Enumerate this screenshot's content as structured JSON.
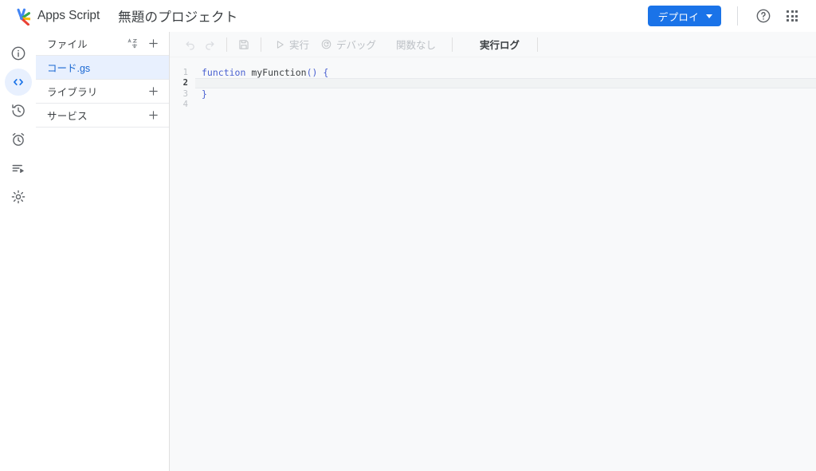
{
  "header": {
    "logo_icon": "apps-script-logo-icon",
    "brand": "Apps Script",
    "project_title": "無題のプロジェクト",
    "deploy_label": "デプロイ",
    "deploy_caret_icon": "chevron-down-icon",
    "help_icon": "help-circle-icon",
    "apps_grid_icon": "apps-grid-icon",
    "accent_color": "#1a73e8"
  },
  "rail": {
    "items": [
      {
        "name": "overview",
        "icon": "info-circle-icon",
        "active": false
      },
      {
        "name": "editor",
        "icon": "code-brackets-icon",
        "active": true
      },
      {
        "name": "project-history",
        "icon": "history-clock-icon",
        "active": false
      },
      {
        "name": "triggers",
        "icon": "alarm-clock-icon",
        "active": false
      },
      {
        "name": "executions",
        "icon": "executions-list-play-icon",
        "active": false
      },
      {
        "name": "project-settings",
        "icon": "gear-icon",
        "active": false
      }
    ],
    "active_bg": "#e8f0fe",
    "active_fg": "#1a73e8"
  },
  "panel": {
    "files_label": "ファイル",
    "sort_icon": "sort-alpha-icon",
    "add_file_icon": "plus-icon",
    "files": [
      {
        "name": "コード.gs",
        "selected": true
      }
    ],
    "libraries_label": "ライブラリ",
    "add_library_icon": "plus-icon",
    "services_label": "サービス",
    "add_service_icon": "plus-icon",
    "selected_bg": "#e8f0fe",
    "selected_fg": "#1967d2"
  },
  "toolbar": {
    "undo_icon": "undo-arrow-icon",
    "redo_icon": "redo-arrow-icon",
    "save_icon": "save-floppy-icon",
    "run_icon": "play-triangle-icon",
    "run_label": "実行",
    "debug_icon": "debug-bug-icon",
    "debug_label": "デバッグ",
    "function_select_value": "関数なし",
    "execution_log_label": "実行ログ",
    "disabled_color": "#bdc1c6"
  },
  "code": {
    "language": "javascript",
    "active_line": 2,
    "lines": [
      {
        "number": "1",
        "tokens": [
          {
            "text": "function",
            "type": "kw"
          },
          {
            "text": " ",
            "type": "plain"
          },
          {
            "text": "myFunction",
            "type": "fn"
          },
          {
            "text": "()",
            "type": "pn"
          },
          {
            "text": " ",
            "type": "plain"
          },
          {
            "text": "{",
            "type": "br"
          }
        ]
      },
      {
        "number": "2",
        "tokens": [
          {
            "text": "  ",
            "type": "plain"
          }
        ]
      },
      {
        "number": "3",
        "tokens": [
          {
            "text": "}",
            "type": "br"
          }
        ]
      },
      {
        "number": "4",
        "tokens": [
          {
            "text": "",
            "type": "plain"
          }
        ]
      }
    ]
  }
}
